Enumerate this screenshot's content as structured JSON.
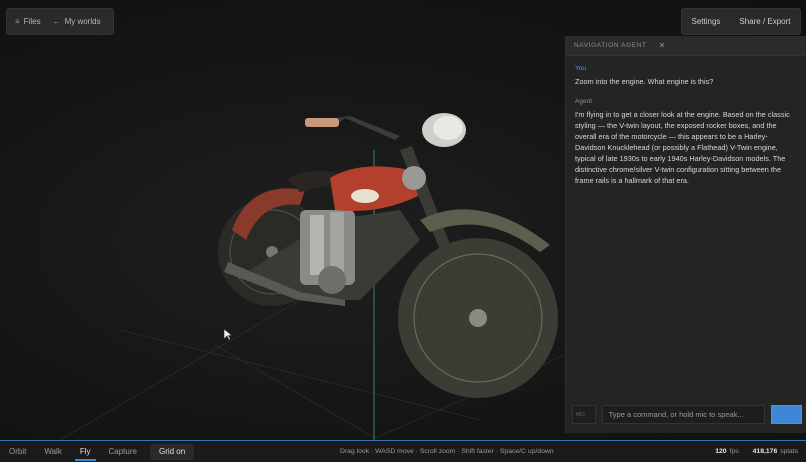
{
  "toolbar_left": {
    "files": {
      "icon": "menu-icon",
      "label": "Files"
    },
    "worlds": {
      "icon": "back-arrow-icon",
      "label": "My worlds"
    }
  },
  "toolbar_right": {
    "settings_label": "Settings",
    "share_label": "Share / Export"
  },
  "panel": {
    "title": "NAVIGATION AGENT",
    "close_icon": "close-icon",
    "messages": [
      {
        "role": "You",
        "text": "Zoom into the engine. What engine is this?"
      },
      {
        "role": "Agent",
        "text": "I'm flying in to get a closer look at the engine. Based on the classic styling — the V-twin layout, the exposed rocker boxes, and the overall era of the motorcycle — this appears to be a Harley-Davidson Knucklehead (or possibly a Flathead) V-Twin engine, typical of late 1930s to early 1940s Harley-Davidson models. The distinctive chrome/silver V-twin configuration sitting between the frame rails is a hallmark of that era."
      }
    ],
    "mic_label": "MIC",
    "input_placeholder": "Type a command, or hold mic to speak..."
  },
  "bottom": {
    "modes": [
      "Orbit",
      "Walk",
      "Fly",
      "Capture"
    ],
    "active_mode": "Fly",
    "grid_label": "Grid on",
    "hints": "Drag look · WASD move · Scroll zoom · Shift faster · Space/C up/down",
    "fps_value": "120",
    "fps_unit": "fps",
    "splats_value": "418,176",
    "splats_unit": "splats"
  },
  "colors": {
    "accent": "#3b86d8",
    "agent_you": "#5a9be0",
    "panel_bg": "#242424",
    "viewport_bg": "#151515"
  }
}
